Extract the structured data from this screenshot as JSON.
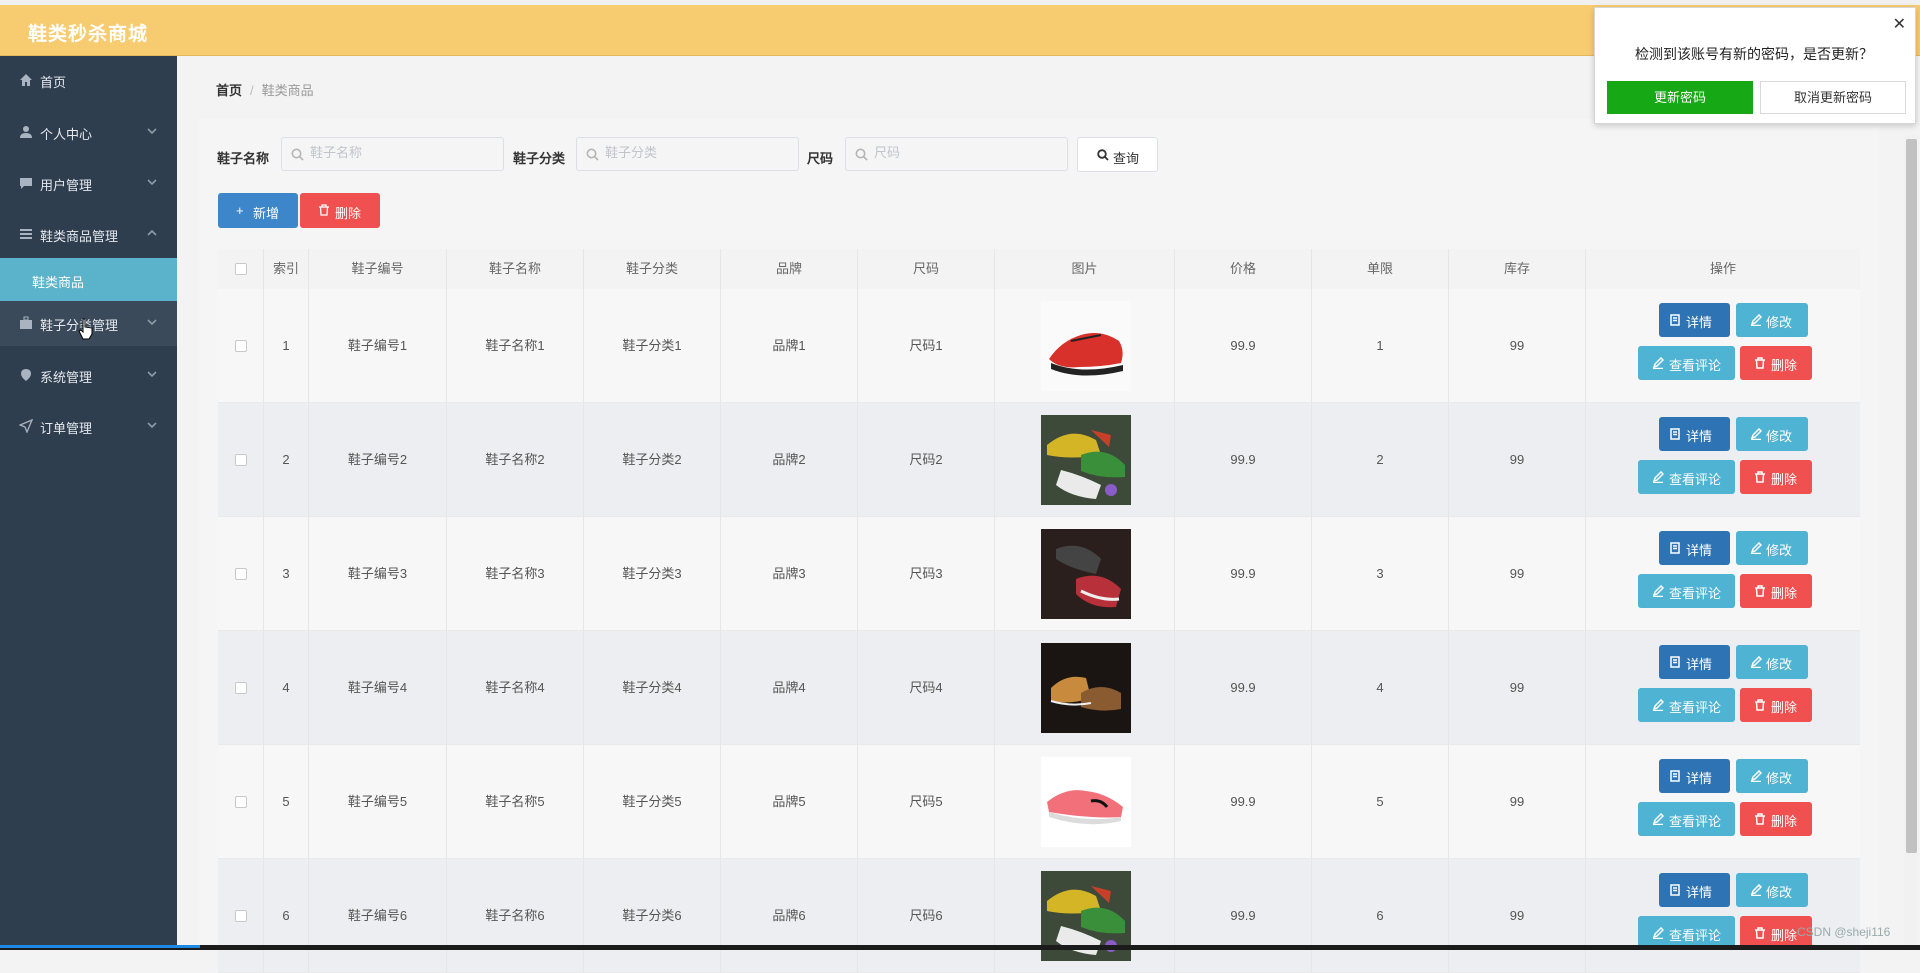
{
  "app": {
    "title": "鞋类秒杀商城"
  },
  "sidebar": {
    "items": [
      {
        "label": "首页",
        "icon": "home-icon"
      },
      {
        "label": "个人中心",
        "icon": "user-icon"
      },
      {
        "label": "用户管理",
        "icon": "chat-icon"
      },
      {
        "label": "鞋类商品管理",
        "icon": "list-icon"
      },
      {
        "label": "鞋子分类管理",
        "icon": "briefcase-icon"
      },
      {
        "label": "系统管理",
        "icon": "pin-icon"
      },
      {
        "label": "订单管理",
        "icon": "send-icon"
      }
    ],
    "submenu": {
      "label": "鞋类商品"
    }
  },
  "breadcrumb": {
    "home": "首页",
    "separator": "/",
    "current": "鞋类商品"
  },
  "search": {
    "name_label": "鞋子名称",
    "name_placeholder": "鞋子名称",
    "category_label": "鞋子分类",
    "category_placeholder": "鞋子分类",
    "size_label": "尺码",
    "size_placeholder": "尺码",
    "query_label": "查询"
  },
  "actions": {
    "add_label": "新增",
    "delete_label": "删除"
  },
  "table": {
    "headers": [
      "索引",
      "鞋子编号",
      "鞋子名称",
      "鞋子分类",
      "品牌",
      "尺码",
      "图片",
      "价格",
      "单限",
      "库存",
      "操作"
    ],
    "buttons": {
      "detail": "详情",
      "edit": "修改",
      "review": "查看评论",
      "delete": "删除"
    },
    "rows": [
      {
        "index": "1",
        "code": "鞋子编号1",
        "name": "鞋子名称1",
        "category": "鞋子分类1",
        "brand": "品牌1",
        "size": "尺码1",
        "image": "red-sneaker",
        "price": "99.9",
        "limit": "1",
        "stock": "99"
      },
      {
        "index": "2",
        "code": "鞋子编号2",
        "name": "鞋子名称2",
        "category": "鞋子分类2",
        "brand": "品牌2",
        "size": "尺码2",
        "image": "colorful-shoes",
        "price": "99.9",
        "limit": "2",
        "stock": "99"
      },
      {
        "index": "3",
        "code": "鞋子编号3",
        "name": "鞋子名称3",
        "category": "鞋子分类3",
        "brand": "品牌3",
        "size": "尺码3",
        "image": "dark-sneakers",
        "price": "99.9",
        "limit": "3",
        "stock": "99"
      },
      {
        "index": "4",
        "code": "鞋子编号4",
        "name": "鞋子名称4",
        "category": "鞋子分类4",
        "brand": "品牌4",
        "size": "尺码4",
        "image": "brown-boots",
        "price": "99.9",
        "limit": "4",
        "stock": "99"
      },
      {
        "index": "5",
        "code": "鞋子编号5",
        "name": "鞋子名称5",
        "category": "鞋子分类5",
        "brand": "品牌5",
        "size": "尺码5",
        "image": "pink-sneakers",
        "price": "99.9",
        "limit": "5",
        "stock": "99"
      },
      {
        "index": "6",
        "code": "鞋子编号6",
        "name": "鞋子名称6",
        "category": "鞋子分类6",
        "brand": "品牌6",
        "size": "尺码6",
        "image": "colorful-shoes",
        "price": "99.9",
        "limit": "6",
        "stock": "99"
      }
    ]
  },
  "popup": {
    "message": "检测到该账号有新的密码，是否更新？",
    "confirm_label": "更新密码",
    "cancel_label": "取消更新密码",
    "close_glyph": "✕"
  },
  "watermark": "CSDN @sheji116",
  "colors": {
    "header": "#f7cb6f",
    "sidebar": "#2f3e4f",
    "active_submenu": "#5ab3cb",
    "primary": "#3c86c9",
    "danger": "#f05050",
    "info": "#4fb3d3",
    "success": "#16a915"
  }
}
